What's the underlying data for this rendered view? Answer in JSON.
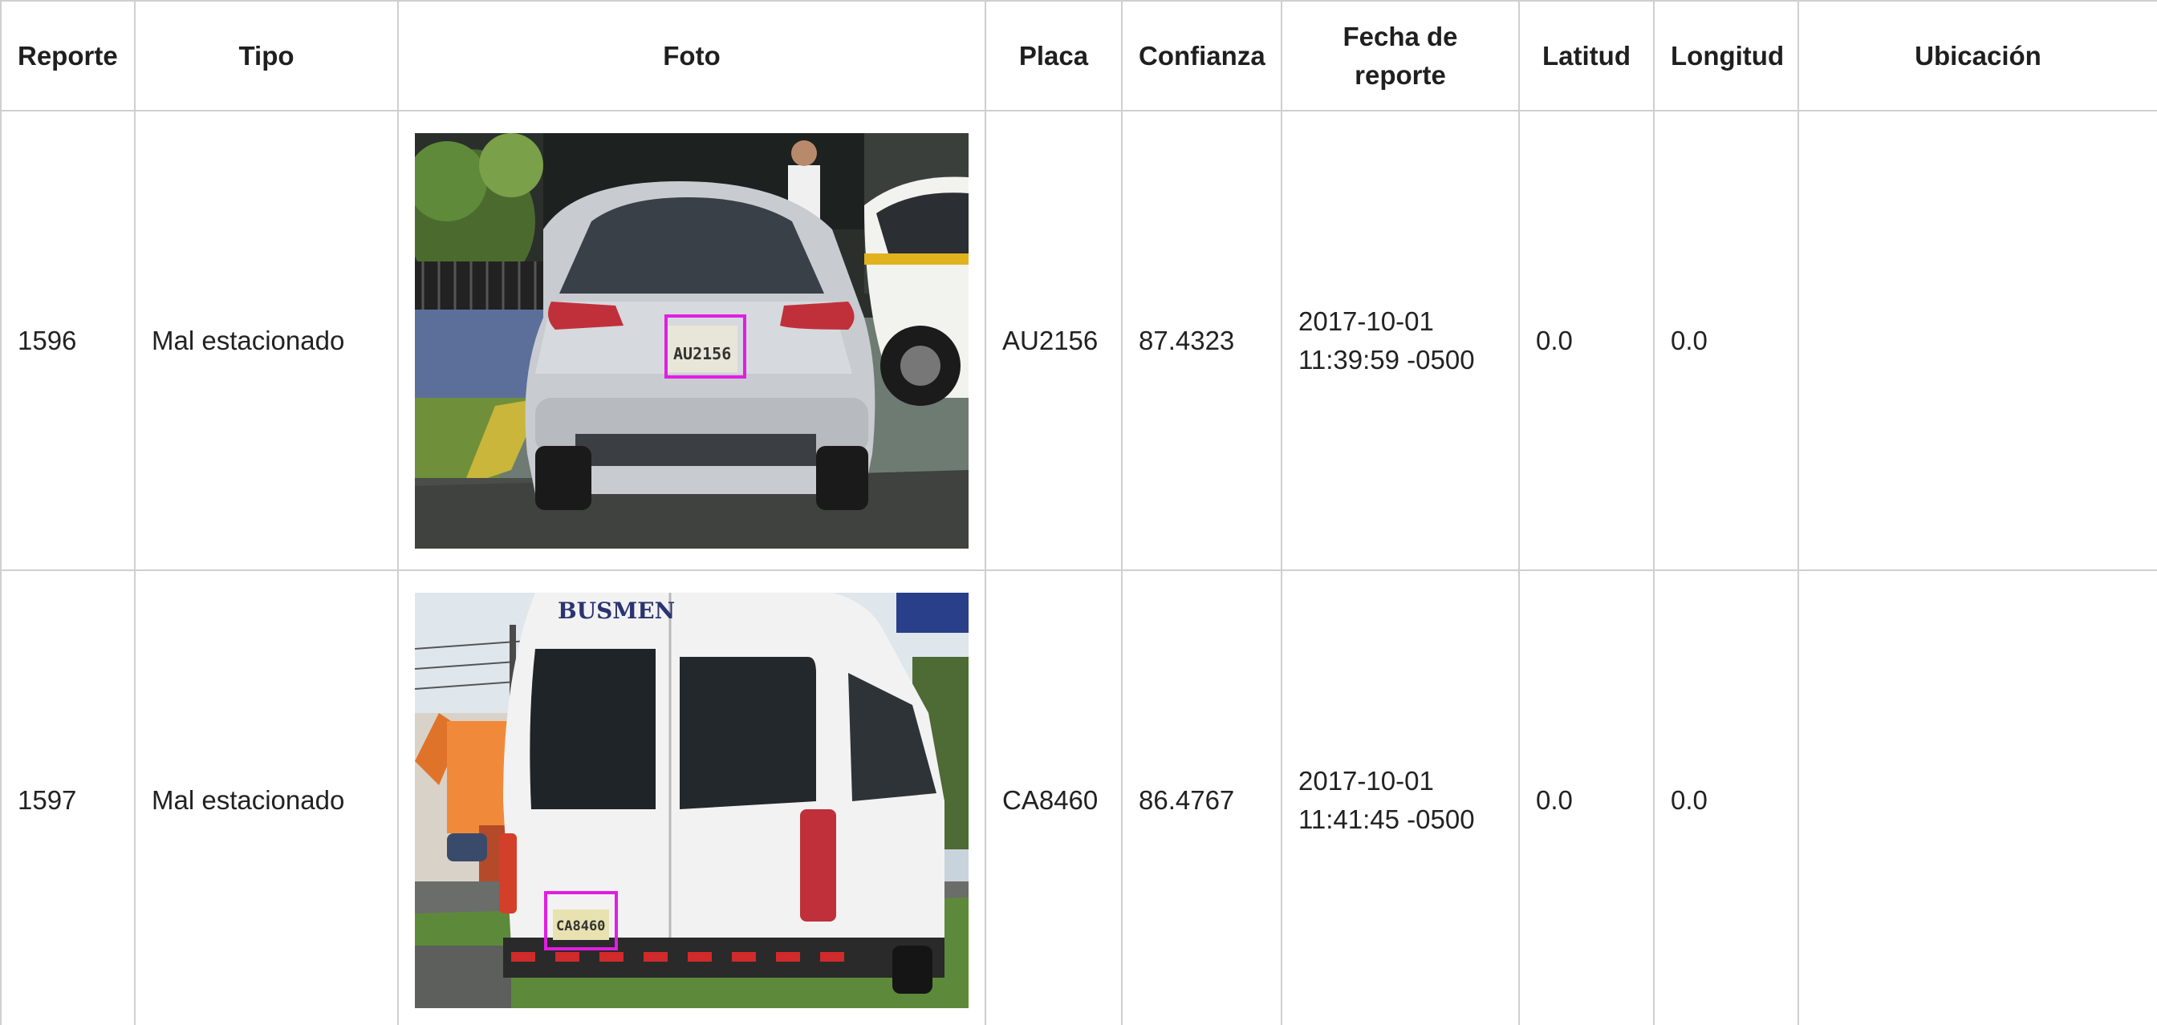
{
  "table": {
    "headers": {
      "reporte": "Reporte",
      "tipo": "Tipo",
      "foto": "Foto",
      "placa": "Placa",
      "confianza": "Confianza",
      "fecha_line1": "Fecha de",
      "fecha_line2": "reporte",
      "latitud": "Latitud",
      "longitud": "Longitud",
      "ubicacion": "Ubicación"
    },
    "rows": [
      {
        "reporte": "1596",
        "tipo": "Mal estacionado",
        "placa": "AU2156",
        "confianza": "87.4323",
        "fecha_date": "2017-10-01",
        "fecha_time": "11:39:59 -0500",
        "latitud": "0.0",
        "longitud": "0.0",
        "ubicacion": "",
        "photo": {
          "subject": "silver SUV parked on curb",
          "plate_text": "AU2156",
          "box_color": "#e11ee1"
        }
      },
      {
        "reporte": "1597",
        "tipo": "Mal estacionado",
        "placa": "CA8460",
        "confianza": "86.4767",
        "fecha_date": "2017-10-01",
        "fecha_time": "11:41:45 -0500",
        "latitud": "0.0",
        "longitud": "0.0",
        "ubicacion": "",
        "photo": {
          "subject": "white Busmen van parked on grass",
          "brand_text": "BUSMEN",
          "plate_text": "CA8460",
          "box_color": "#e11ee1"
        }
      }
    ]
  }
}
